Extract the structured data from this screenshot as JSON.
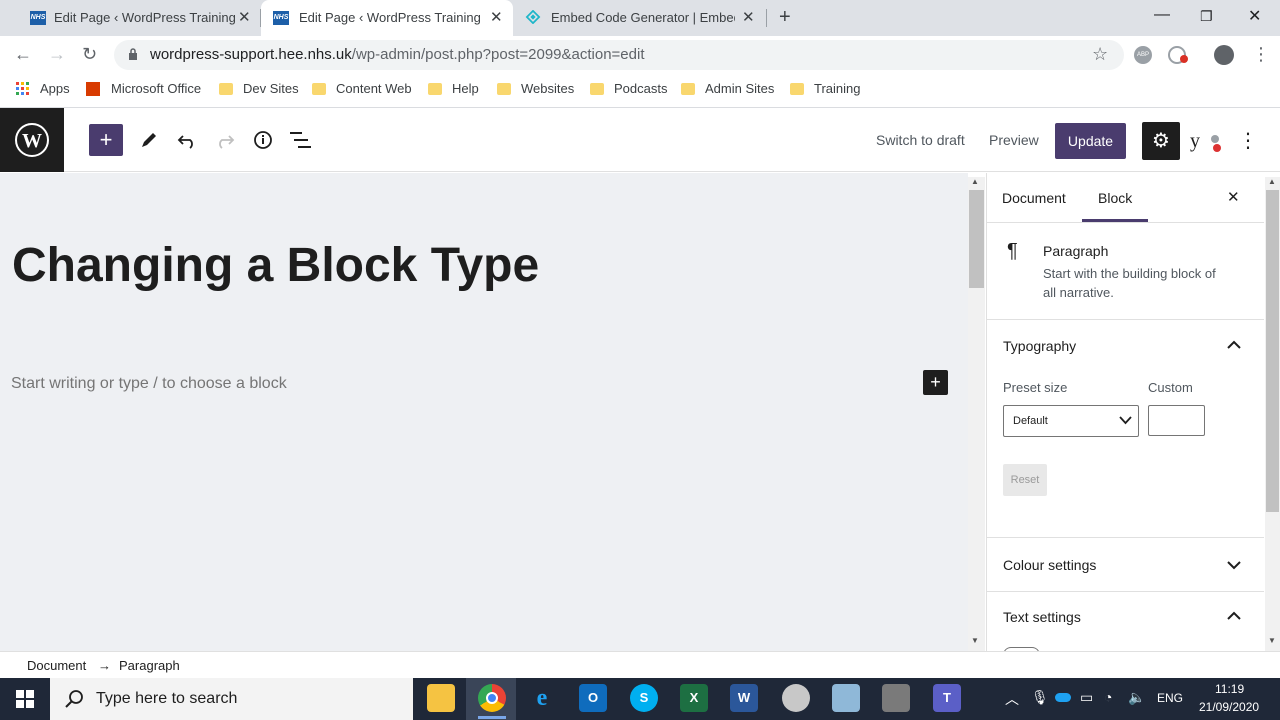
{
  "browser": {
    "tabs": [
      {
        "title": "Edit Page ‹ WordPress Training &",
        "favicon": "NHS"
      },
      {
        "title": "Edit Page ‹ WordPress Training &",
        "favicon": "NHS"
      },
      {
        "title": "Embed Code Generator | Embed",
        "favicon": "embed-diamond-icon"
      }
    ],
    "new_tab": "+",
    "url_host": "wordpress-support.hee.nhs.uk",
    "url_path": "/wp-admin/post.php?post=2099&action=edit",
    "bookmarks": [
      "Apps",
      "Microsoft Office",
      "Dev Sites",
      "Content Web",
      "Help",
      "Websites",
      "Podcasts",
      "Admin Sites",
      "Training"
    ]
  },
  "wp": {
    "header": {
      "switch_to_draft": "Switch to draft",
      "preview": "Preview",
      "update": "Update",
      "yoast": "y"
    },
    "post_title": "Changing a Block Type",
    "placeholder": "Start writing or type / to choose a block",
    "sidebar": {
      "tabs": [
        "Document",
        "Block"
      ],
      "active_tab": "Block",
      "block_name": "Paragraph",
      "block_desc_1": "Start with the building block of",
      "block_desc_2": "all narrative.",
      "typography": "Typography",
      "preset_size": "Preset size",
      "custom": "Custom",
      "preset_value": "Default",
      "reset": "Reset",
      "colour_settings": "Colour settings",
      "text_settings": "Text settings"
    },
    "breadcrumb": [
      "Document",
      "→",
      "Paragraph"
    ]
  },
  "taskbar": {
    "search_placeholder": "Type here to search",
    "lang": "ENG",
    "time": "11:19",
    "date": "21/09/2020"
  },
  "colors": {
    "wp_accent": "#4a3c6e",
    "wp_dark": "#1e1e1e",
    "canvas_bg": "#eef0f3",
    "taskbar_bg": "#1f2838"
  }
}
